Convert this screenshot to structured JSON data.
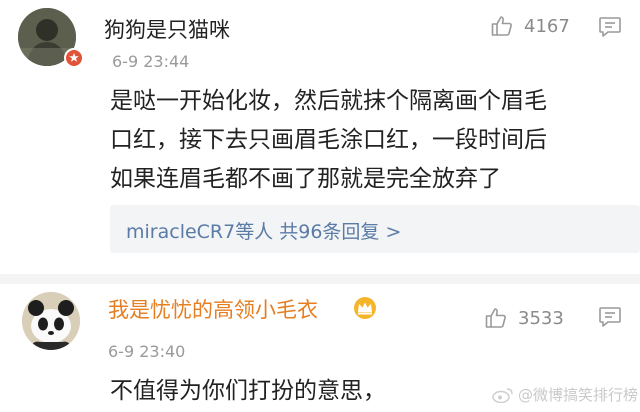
{
  "comments": [
    {
      "username": "狗狗是只猫咪",
      "time": "6-9 23:44",
      "likes": "4167",
      "text_lines": [
        "是哒一开始化妆，然后就抹个隔离画个眉毛",
        "口红，接下去只画眉毛涂口红，一段时间后",
        "如果连眉毛都不画了那就是完全放弃了"
      ],
      "reply_summary": "miracleCR7等人  共96条回复 >"
    },
    {
      "username": "我是忧忧的高领小毛衣",
      "time": "6-9 23:40",
      "likes": "3533",
      "text_lines": [
        "不值得为你们打扮的意思，"
      ]
    }
  ],
  "watermark": "@微博搞笑排行榜",
  "icons": {
    "like": "thumbs-up-icon",
    "comment": "comment-icon",
    "badge": "verified-badge-icon",
    "crown": "vip-crown-icon"
  },
  "colors": {
    "vip_name": "#e67e22",
    "reply_link": "#5a7ba6",
    "badge": "#e2543a"
  }
}
